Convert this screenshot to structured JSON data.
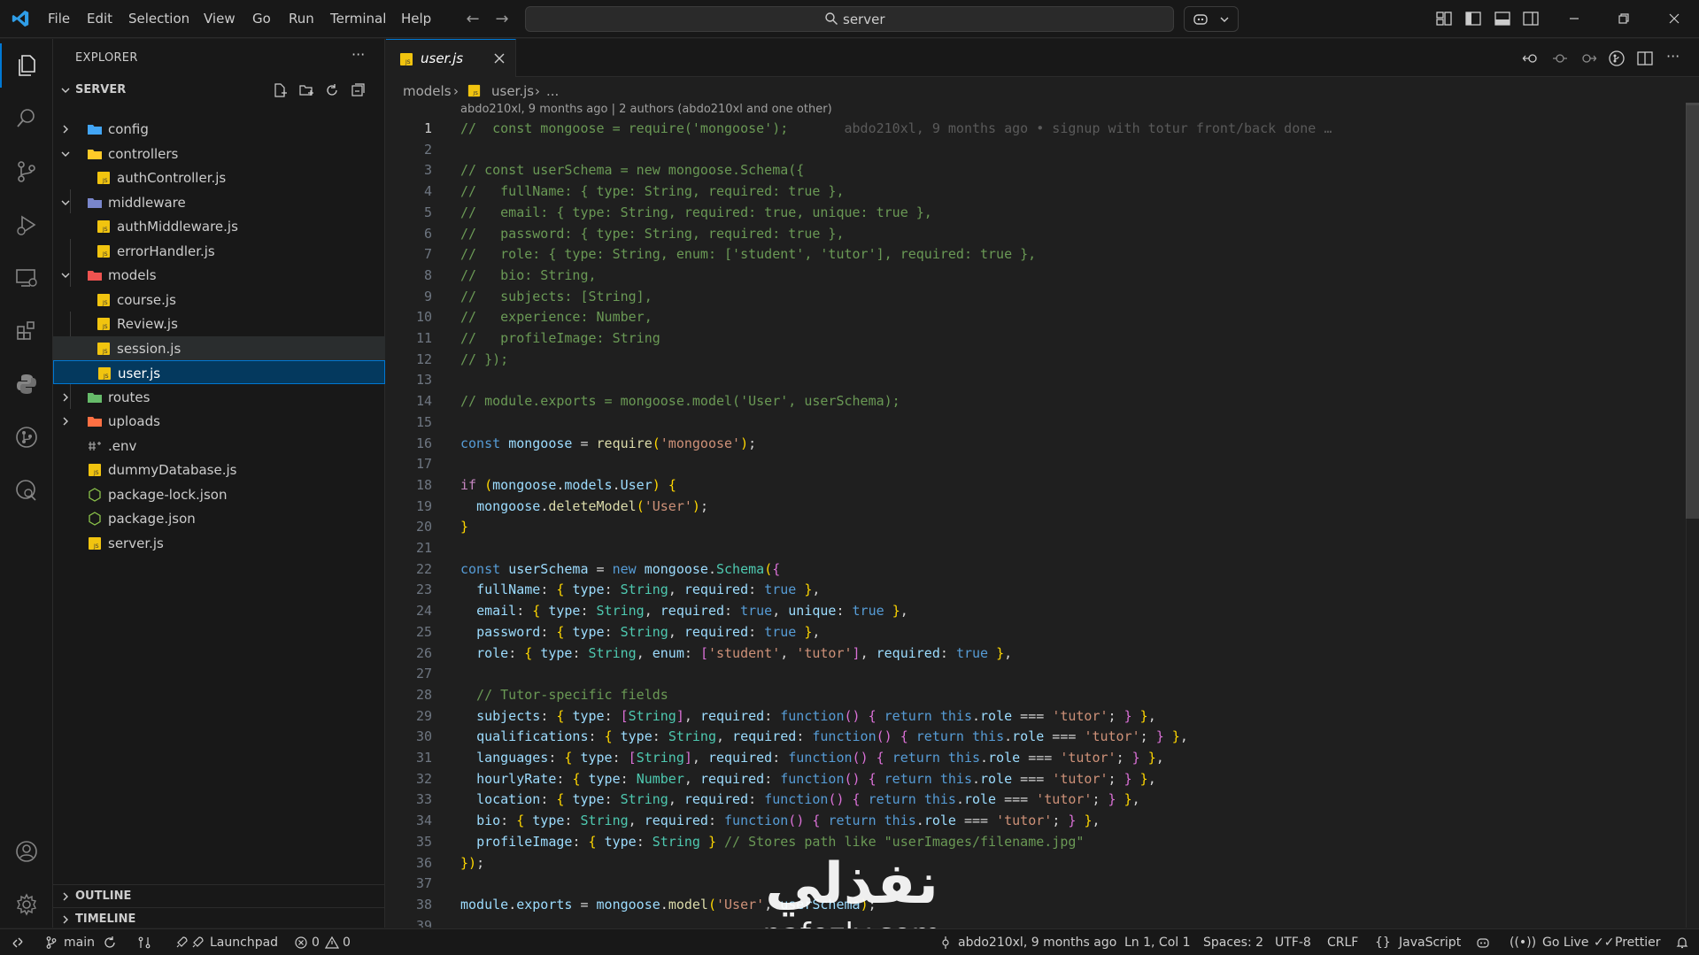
{
  "titlebar": {
    "menu": [
      "File",
      "Edit",
      "Selection",
      "View",
      "Go",
      "Run",
      "Terminal",
      "Help"
    ],
    "search_text": "server"
  },
  "sidebar": {
    "title": "EXPLORER",
    "more": "···",
    "section": "SERVER",
    "tree": [
      {
        "label": "config",
        "kind": "folder",
        "icon": "config-folder-icon"
      },
      {
        "label": "controllers",
        "kind": "folder-open",
        "icon": "controllers-folder-icon"
      },
      {
        "label": "authController.js",
        "kind": "file",
        "icon": "js-file-icon"
      },
      {
        "label": "middleware",
        "kind": "folder-open",
        "icon": "middleware-folder-icon"
      },
      {
        "label": "authMiddleware.js",
        "kind": "file",
        "icon": "js-file-icon"
      },
      {
        "label": "errorHandler.js",
        "kind": "file",
        "icon": "js-file-icon"
      },
      {
        "label": "models",
        "kind": "folder-open",
        "icon": "models-folder-icon"
      },
      {
        "label": "course.js",
        "kind": "file",
        "icon": "js-file-icon"
      },
      {
        "label": "Review.js",
        "kind": "file",
        "icon": "js-file-icon"
      },
      {
        "label": "session.js",
        "kind": "file",
        "icon": "js-file-icon"
      },
      {
        "label": "user.js",
        "kind": "file",
        "icon": "js-file-icon"
      },
      {
        "label": "routes",
        "kind": "folder",
        "icon": "routes-folder-icon"
      },
      {
        "label": "uploads",
        "kind": "folder",
        "icon": "uploads-folder-icon"
      },
      {
        "label": ".env",
        "kind": "file",
        "icon": "env-file-icon"
      },
      {
        "label": "dummyDatabase.js",
        "kind": "file",
        "icon": "js-file-icon"
      },
      {
        "label": "package-lock.json",
        "kind": "file",
        "icon": "json-file-icon"
      },
      {
        "label": "package.json",
        "kind": "file",
        "icon": "json-file-icon"
      },
      {
        "label": "server.js",
        "kind": "file",
        "icon": "js-file-icon"
      }
    ],
    "outline": "OUTLINE",
    "timeline": "TIMELINE"
  },
  "editor": {
    "tab_label": "user.js",
    "breadcrumb": [
      "models",
      "user.js",
      "..."
    ],
    "blame_header": "abdo210xl, 9 months ago | 2 authors (abdo210xl and one other)",
    "inline_blame": "abdo210xl, 9 months ago • signup with totur front/back done …",
    "current_line": 1,
    "lines": [
      "//  const mongoose = require('mongoose');",
      "",
      "// const userSchema = new mongoose.Schema({",
      "//   fullName: { type: String, required: true },",
      "//   email: { type: String, required: true, unique: true },",
      "//   password: { type: String, required: true },",
      "//   role: { type: String, enum: ['student', 'tutor'], required: true },",
      "//   bio: String,",
      "//   subjects: [String],",
      "//   experience: Number,",
      "//   profileImage: String",
      "// });",
      "",
      "// module.exports = mongoose.model('User', userSchema);",
      "",
      "const mongoose = require('mongoose');",
      "",
      "if (mongoose.models.User) {",
      "  mongoose.deleteModel('User');",
      "}",
      "",
      "const userSchema = new mongoose.Schema({",
      "  fullName: { type: String, required: true },",
      "  email: { type: String, required: true, unique: true },",
      "  password: { type: String, required: true },",
      "  role: { type: String, enum: ['student', 'tutor'], required: true },",
      "",
      "  // Tutor-specific fields",
      "  subjects: { type: [String], required: function() { return this.role === 'tutor'; } },",
      "  qualifications: { type: String, required: function() { return this.role === 'tutor'; } },",
      "  languages: { type: [String], required: function() { return this.role === 'tutor'; } },",
      "  hourlyRate: { type: Number, required: function() { return this.role === 'tutor'; } },",
      "  location: { type: String, required: function() { return this.role === 'tutor'; } },",
      "  bio: { type: String, required: function() { return this.role === 'tutor'; } },",
      "  profileImage: { type: String } // Stores path like \"userImages/filename.jpg\"",
      "});",
      "",
      "module.exports = mongoose.model('User', userSchema);",
      ""
    ]
  },
  "watermark": {
    "arabic": "نفذلي",
    "latin": "nafezly.com"
  },
  "statusbar": {
    "branch": "main",
    "launchpad": "Launchpad",
    "errors": "0",
    "warnings": "0",
    "blame": "abdo210xl, 9 months ago",
    "position": "Ln 1, Col 1",
    "spaces": "Spaces: 2",
    "encoding": "UTF-8",
    "eol": "CRLF",
    "language": "JavaScript",
    "golive": "Go Live",
    "prettier": "Prettier"
  },
  "colors": {
    "accent": "#0078d4",
    "keyword": "#569cd6",
    "string": "#ce9178",
    "comment": "#6a9955",
    "variable": "#9cdcfe",
    "function": "#dcdcaa",
    "type": "#4ec9b0",
    "control": "#c586c0"
  }
}
